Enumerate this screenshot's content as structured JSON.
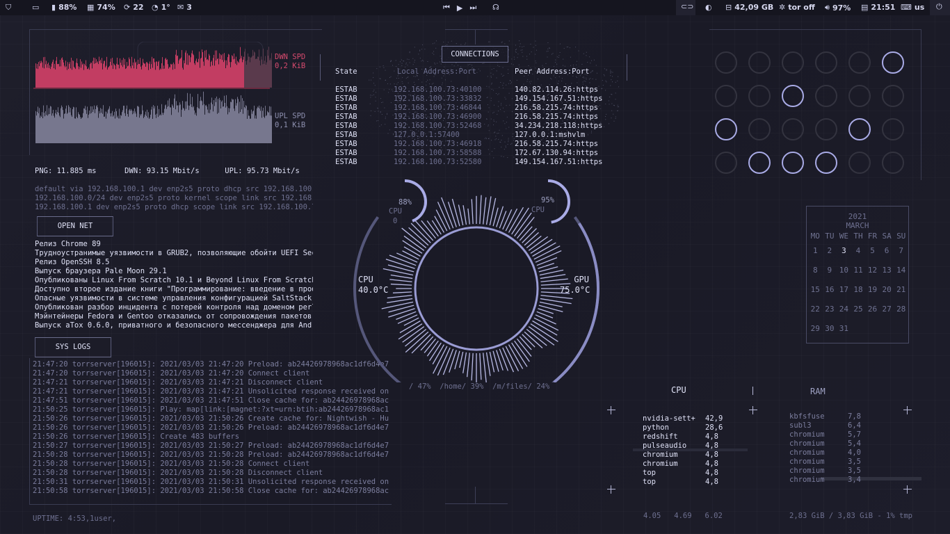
{
  "topbar": {
    "shield_pct": "",
    "battery": "88%",
    "memory": "74%",
    "updates": "22",
    "load": "1°",
    "mail": "3",
    "disk": "42,09 GB",
    "tor": "tor off",
    "volume": "97%",
    "clock": "21:51",
    "keyboard": "us"
  },
  "net": {
    "down_label": "DWN SPD",
    "down_value": "0,2 KiB",
    "up_label": "UPL SPD",
    "up_value": "0,1 KiB",
    "ping": "PNG: 11.885 ms",
    "dwn_rate": "DWN: 93.15 Mbit/s",
    "upl_rate": "UPL: 95.73 Mbit/s",
    "routes": [
      "default via 192.168.100.1 dev enp2s5 proto dhcp src 192.168.100.73",
      "192.168.100.0/24 dev enp2s5 proto kernel scope link src 192.168.10",
      "192.168.100.1 dev enp2s5 proto dhcp scope link src 192.168.100.73"
    ]
  },
  "opennet": {
    "title": "OPEN NET",
    "items": [
      "Релиз Chrome 89",
      "Труднoустранимые уязвимости в GRUB2, позволяющие обойти UEFI Secur",
      "Релиз OpenSSH 8.5",
      "Выпуск браузера Pale Moon 29.1",
      "Опубликованы Linux From Scratch 10.1 и Beyond Linux From Scratch 1",
      "Доступно второе издание книги \"Программирование: введение в профес",
      "Опасные уязвимости в системе управления конфигурацией SaltStack",
      "Опубликован разбор инцидента с потерей контроля над доменом perl.c",
      "Мэйнтейнеры Fedora и Gentoo отказались от сопровождения пакетов с",
      "Выпуск aTox 0.6.0, приватного и безопасного мессенджера для Androi"
    ]
  },
  "syslogs": {
    "title": "SYS LOGS",
    "rows": [
      {
        "t": "21:47:20",
        "p": "torrserver[196015]:",
        "m": "2021/03/03 21:47:20 Preload: ab24426978968ac1df6d4e7405"
      },
      {
        "t": "21:47:20",
        "p": "torrserver[196015]:",
        "m": "2021/03/03 21:47:20 Connect client"
      },
      {
        "t": "21:47:21",
        "p": "torrserver[196015]:",
        "m": "2021/03/03 21:47:21 Disconnect client"
      },
      {
        "t": "21:47:21",
        "p": "torrserver[196015]:",
        "m": "2021/03/03 21:47:21 Unsolicited response received on id"
      },
      {
        "t": "21:47:51",
        "p": "torrserver[196015]:",
        "m": "2021/03/03 21:47:51 Close cache for: ab24426978968ac1df"
      },
      {
        "t": "21:50:25",
        "p": "torrserver[196015]:",
        "m": "Play: map[link:[magnet:?xt=urn:btih:ab24426978968ac1df6"
      },
      {
        "t": "21:50:26",
        "p": "torrserver[196015]:",
        "m": "2021/03/03 21:50:26 Create cache for: Nightwish - Human"
      },
      {
        "t": "21:50:26",
        "p": "torrserver[196015]:",
        "m": "2021/03/03 21:50:26 Preload: ab24426978968ac1df6d4e7405"
      },
      {
        "t": "21:50:26",
        "p": "torrserver[196015]:",
        "m": "Create 483 buffers"
      },
      {
        "t": "21:50:27",
        "p": "torrserver[196015]:",
        "m": "2021/03/03 21:50:27 Preload: ab24426978968ac1df6d4e7405"
      },
      {
        "t": "21:50:28",
        "p": "torrserver[196015]:",
        "m": "2021/03/03 21:50:28 Preload: ab24426978968ac1df6d4e7405"
      },
      {
        "t": "21:50:28",
        "p": "torrserver[196015]:",
        "m": "2021/03/03 21:50:28 Connect client"
      },
      {
        "t": "21:50:28",
        "p": "torrserver[196015]:",
        "m": "2021/03/03 21:50:28 Disconnect client"
      },
      {
        "t": "21:50:31",
        "p": "torrserver[196015]:",
        "m": "2021/03/03 21:50:31 Unsolicited response received on id"
      },
      {
        "t": "21:50:58",
        "p": "torrserver[196015]:",
        "m": "2021/03/03 21:50:58 Close cache for: ab24426978968ac1df"
      }
    ],
    "uptime": "UPTIME: 4:53,1user,"
  },
  "connections": {
    "title": "CONNECTIONS",
    "headers": [
      "State",
      "Local Address:Port",
      "Peer Address:Port"
    ],
    "rows": [
      [
        "ESTAB",
        "192.168.100.73:40100",
        "140.82.114.26:https"
      ],
      [
        "ESTAB",
        "192.168.100.73:33832",
        "149.154.167.51:https"
      ],
      [
        "ESTAB",
        "192.168.100.73:46844",
        "216.58.215.74:https"
      ],
      [
        "ESTAB",
        "192.168.100.73:46900",
        "216.58.215.74:https"
      ],
      [
        "ESTAB",
        "192.168.100.73:52468",
        "34.234.218.118:https"
      ],
      [
        "ESTAB",
        "127.0.0.1:57400",
        "127.0.0.1:mshvlm"
      ],
      [
        "ESTAB",
        "192.168.100.73:46918",
        "216.58.215.74:https"
      ],
      [
        "ESTAB",
        "192.168.100.73:58588",
        "172.67.130.94:https"
      ],
      [
        "ESTAB",
        "192.168.100.73:52580",
        "149.154.167.51:https"
      ]
    ]
  },
  "gauges": {
    "cpu1_pct": "88%",
    "cpu1_label": "CPU",
    "cpu1_zero": "0",
    "cpu2_pct": "95%",
    "cpu2_label": "CPU",
    "cpu_temp_label": "CPU",
    "cpu_temp": "40.0°C",
    "gpu_temp_label": "GPU",
    "gpu_temp": "75.0°C",
    "disks": "/ 47%  /home/ 39%  /m/files/ 24%",
    "cpu1_value": 0.88,
    "cpu2_value": 0.95
  },
  "dots": [
    [
      0,
      0,
      0,
      0,
      0,
      1
    ],
    [
      0,
      0,
      1,
      0,
      0,
      0
    ],
    [
      1,
      0,
      0,
      0,
      1,
      0
    ],
    [
      0,
      1,
      1,
      1,
      0,
      0
    ]
  ],
  "calendar": {
    "year": "2021",
    "month": "MARCH",
    "days": [
      "MO",
      "TU",
      "WE",
      "TH",
      "FR",
      "SA",
      "SU"
    ],
    "weeks": [
      [
        "1",
        "2",
        "3",
        "4",
        "5",
        "6",
        "7"
      ],
      [
        "8",
        "9",
        "10",
        "11",
        "12",
        "13",
        "14"
      ],
      [
        "15",
        "16",
        "17",
        "18",
        "19",
        "20",
        "21"
      ],
      [
        "22",
        "23",
        "24",
        "25",
        "26",
        "27",
        "28"
      ],
      [
        "29",
        "30",
        "31",
        "",
        "",
        "",
        ""
      ]
    ],
    "today": "3"
  },
  "procs": {
    "cpu_title": "CPU",
    "ram_title": "RAM",
    "cpu": [
      [
        "nvidia-sett+",
        "42,9"
      ],
      [
        "python",
        "28,6"
      ],
      [
        "redshift",
        "4,8"
      ],
      [
        "pulseaudio",
        "4,8"
      ],
      [
        "chromium",
        "4,8"
      ],
      [
        "chromium",
        "4,8"
      ],
      [
        "top",
        "4,8"
      ],
      [
        "top",
        "4,8"
      ]
    ],
    "ram": [
      [
        "kbfsfuse",
        "7,8"
      ],
      [
        "subl3",
        "6,4"
      ],
      [
        "chromium",
        "5,7"
      ],
      [
        "chromium",
        "5,4"
      ],
      [
        "chromium",
        "4,0"
      ],
      [
        "chromium",
        "3,5"
      ],
      [
        "chromium",
        "3,5"
      ],
      [
        "chromium",
        "3,4"
      ]
    ],
    "loadavg": "4.05   4.69   6.02",
    "ram_summary": "2,83 GiB / 3,83 GiB - 1% tmp"
  },
  "colors": {
    "accent": "#a9abe6",
    "down": "#d64a6e",
    "up": "#8a8aa6"
  }
}
